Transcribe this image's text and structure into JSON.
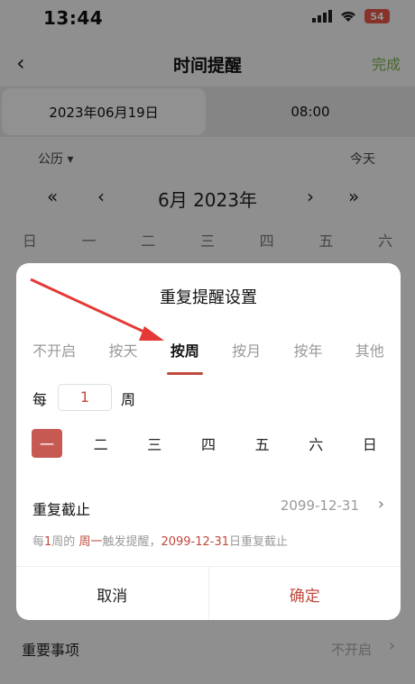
{
  "status_bar": {
    "time": "13:44",
    "battery": "54"
  },
  "nav": {
    "back_glyph": "‹",
    "title": "时间提醒",
    "done_label": "完成"
  },
  "date_tabs": {
    "date": "2023年06月19日",
    "time": "08:00"
  },
  "calendar": {
    "type_label": "公历 ▾",
    "today_label": "今天",
    "prev_year": "«",
    "prev_month": "‹",
    "month_label": "6月 2023年",
    "next_month": "›",
    "next_year": "»",
    "weekdays": [
      "日",
      "一",
      "二",
      "三",
      "四",
      "五",
      "六"
    ]
  },
  "important": {
    "label": "重要事项",
    "value": "不开启"
  },
  "dialog": {
    "title": "重复提醒设置",
    "tabs": [
      "不开启",
      "按天",
      "按周",
      "按月",
      "按年",
      "其他"
    ],
    "active_tab_index": 2,
    "every_label": "每",
    "every_value": "1",
    "every_unit": "周",
    "days": [
      "一",
      "二",
      "三",
      "四",
      "五",
      "六",
      "日"
    ],
    "selected_day_index": 0,
    "repeat_end_label": "重复截止",
    "repeat_end_date": "2099-12-31",
    "summary": {
      "p1": "每",
      "n": "1",
      "p2": "周的 ",
      "day": "周一",
      "p3": "触发提醒，",
      "date": "2099-12-31",
      "p4": "日重复截止"
    },
    "cancel_label": "取消",
    "ok_label": "确定"
  },
  "colors": {
    "accent": "#c0493d",
    "done": "#7fb24a",
    "selected_day": "#c65a52"
  }
}
